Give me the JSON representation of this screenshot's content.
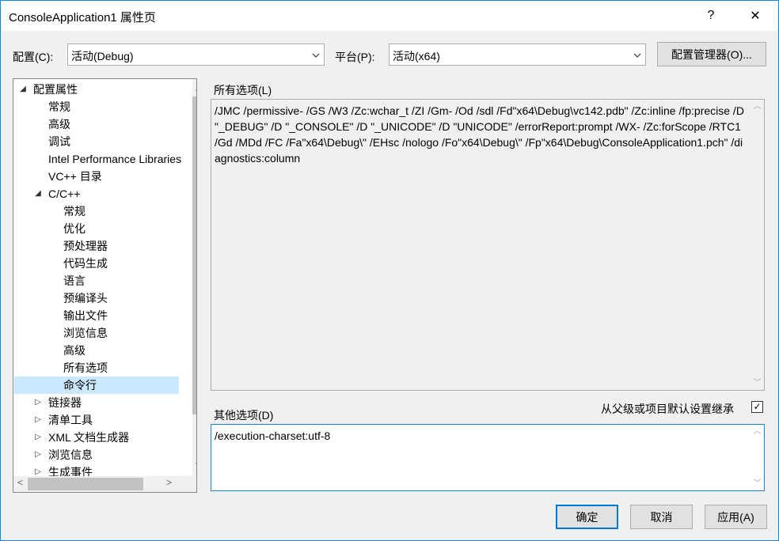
{
  "window": {
    "title": "ConsoleApplication1 属性页",
    "help_glyph": "?",
    "close_glyph": "✕"
  },
  "config": {
    "label": "配置(C):",
    "value": "活动(Debug)"
  },
  "platform": {
    "label": "平台(P):",
    "value": "活动(x64)"
  },
  "config_manager_label": "配置管理器(O)...",
  "tree": {
    "items": [
      {
        "label": "配置属性",
        "expander": "◢"
      },
      {
        "label": "常规"
      },
      {
        "label": "高级"
      },
      {
        "label": "调试"
      },
      {
        "label": "Intel Performance Libraries"
      },
      {
        "label": "VC++ 目录"
      },
      {
        "label": "C/C++",
        "expander": "◢"
      },
      {
        "label": "常规"
      },
      {
        "label": "优化"
      },
      {
        "label": "预处理器"
      },
      {
        "label": "代码生成"
      },
      {
        "label": "语言"
      },
      {
        "label": "预编译头"
      },
      {
        "label": "输出文件"
      },
      {
        "label": "浏览信息"
      },
      {
        "label": "高级"
      },
      {
        "label": "所有选项"
      },
      {
        "label": "命令行",
        "selected": true
      },
      {
        "label": "链接器",
        "expander": "▷"
      },
      {
        "label": "清单工具",
        "expander": "▷"
      },
      {
        "label": "XML 文档生成器",
        "expander": "▷"
      },
      {
        "label": "浏览信息",
        "expander": "▷"
      },
      {
        "label": "生成事件",
        "expander": "▷"
      }
    ]
  },
  "all_options": {
    "label": "所有选项(L)",
    "text": "/JMC /permissive- /GS /W3 /Zc:wchar_t /ZI /Gm- /Od /sdl /Fd\"x64\\Debug\\vc142.pdb\" /Zc:inline /fp:precise /D \"_DEBUG\" /D \"_CONSOLE\" /D \"_UNICODE\" /D \"UNICODE\" /errorReport:prompt /WX- /Zc:forScope /RTC1 /Gd /MDd /FC /Fa\"x64\\Debug\\\" /EHsc /nologo /Fo\"x64\\Debug\\\" /Fp\"x64\\Debug\\ConsoleApplication1.pch\" /diagnostics:column"
  },
  "other_options": {
    "label": "其他选项(D)",
    "value": "/execution-charset:utf-8"
  },
  "inherit": {
    "label": "从父级或项目默认设置继承",
    "checked": true,
    "check_glyph": "✓"
  },
  "buttons": {
    "ok": "确定",
    "cancel": "取消",
    "apply": "应用(A)"
  },
  "glyphs": {
    "up": "︿",
    "down": "﹀",
    "left": "<",
    "right": ">"
  }
}
